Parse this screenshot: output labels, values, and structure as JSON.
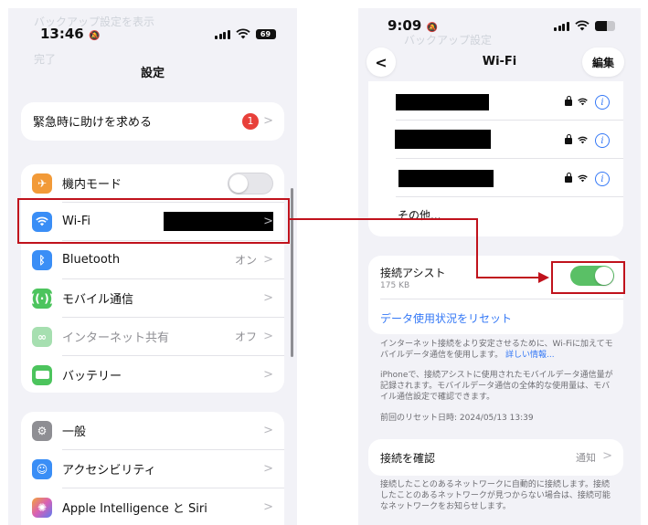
{
  "left": {
    "status": {
      "time": "13:46",
      "battery": "69"
    },
    "ghost_title": "バックアップ設定を表示",
    "ghost_done": "完了",
    "title": "設定",
    "emergency": {
      "label": "緊急時に助けを求める",
      "badge": "1"
    },
    "group1": [
      {
        "label": "機内モード",
        "icon": "airplane-icon",
        "color": "#f29a38"
      },
      {
        "label": "Wi-Fi",
        "icon": "wifi-icon",
        "color": "#3a8ef6"
      },
      {
        "label": "Bluetooth",
        "icon": "bluetooth-icon",
        "color": "#3a8ef6",
        "value": "オン"
      },
      {
        "label": "モバイル通信",
        "icon": "antenna-icon",
        "color": "#4cc45d"
      },
      {
        "label": "インターネット共有",
        "icon": "link-icon",
        "color": "#a6dfb0",
        "value": "オフ"
      },
      {
        "label": "バッテリー",
        "icon": "battery-icon",
        "color": "#4cc45d"
      }
    ],
    "group2": [
      {
        "label": "一般",
        "icon": "gear-icon",
        "color": "#8e8e93"
      },
      {
        "label": "アクセシビリティ",
        "icon": "accessibility-icon",
        "color": "#3a8ef6"
      },
      {
        "label": "Apple Intelligence と Siri",
        "icon": "siri-icon",
        "color": "#d85fb5"
      }
    ]
  },
  "right": {
    "status": {
      "time": "9:09"
    },
    "ghost_back": "バックアップ設定",
    "title": "Wi-Fi",
    "edit": "編集",
    "other": "その他...",
    "assist": {
      "label": "接続アシスト",
      "usage": "175 KB",
      "reset": "データ使用状況をリセット",
      "enabled": true
    },
    "desc1a": "インターネット接続をより安定させるために、Wi-Fiに加えてモ",
    "desc1b": "バイルデータ通信を使用します。",
    "desc1_link": "詳しい情報...",
    "desc2": [
      "iPhoneで、接続アシストに使用されたモバイルデータ通信量が",
      "記録されます。モバイルデータ通信の全体的な使用量は、モバ",
      "イル通信設定で確認できます。"
    ],
    "last_reset": "前回のリセット日時: 2024/05/13 13:39",
    "ask": {
      "label": "接続を確認",
      "value": "通知"
    },
    "desc3": [
      "接続したことのあるネットワークに自動的に接続します。接続",
      "したことのあるネットワークが見つからない場合は、接続可能",
      "なネットワークをお知らせします。"
    ]
  },
  "colors": {
    "highlight": "#c0121c",
    "link": "#3478f6",
    "toggle_on": "#5ac066"
  }
}
